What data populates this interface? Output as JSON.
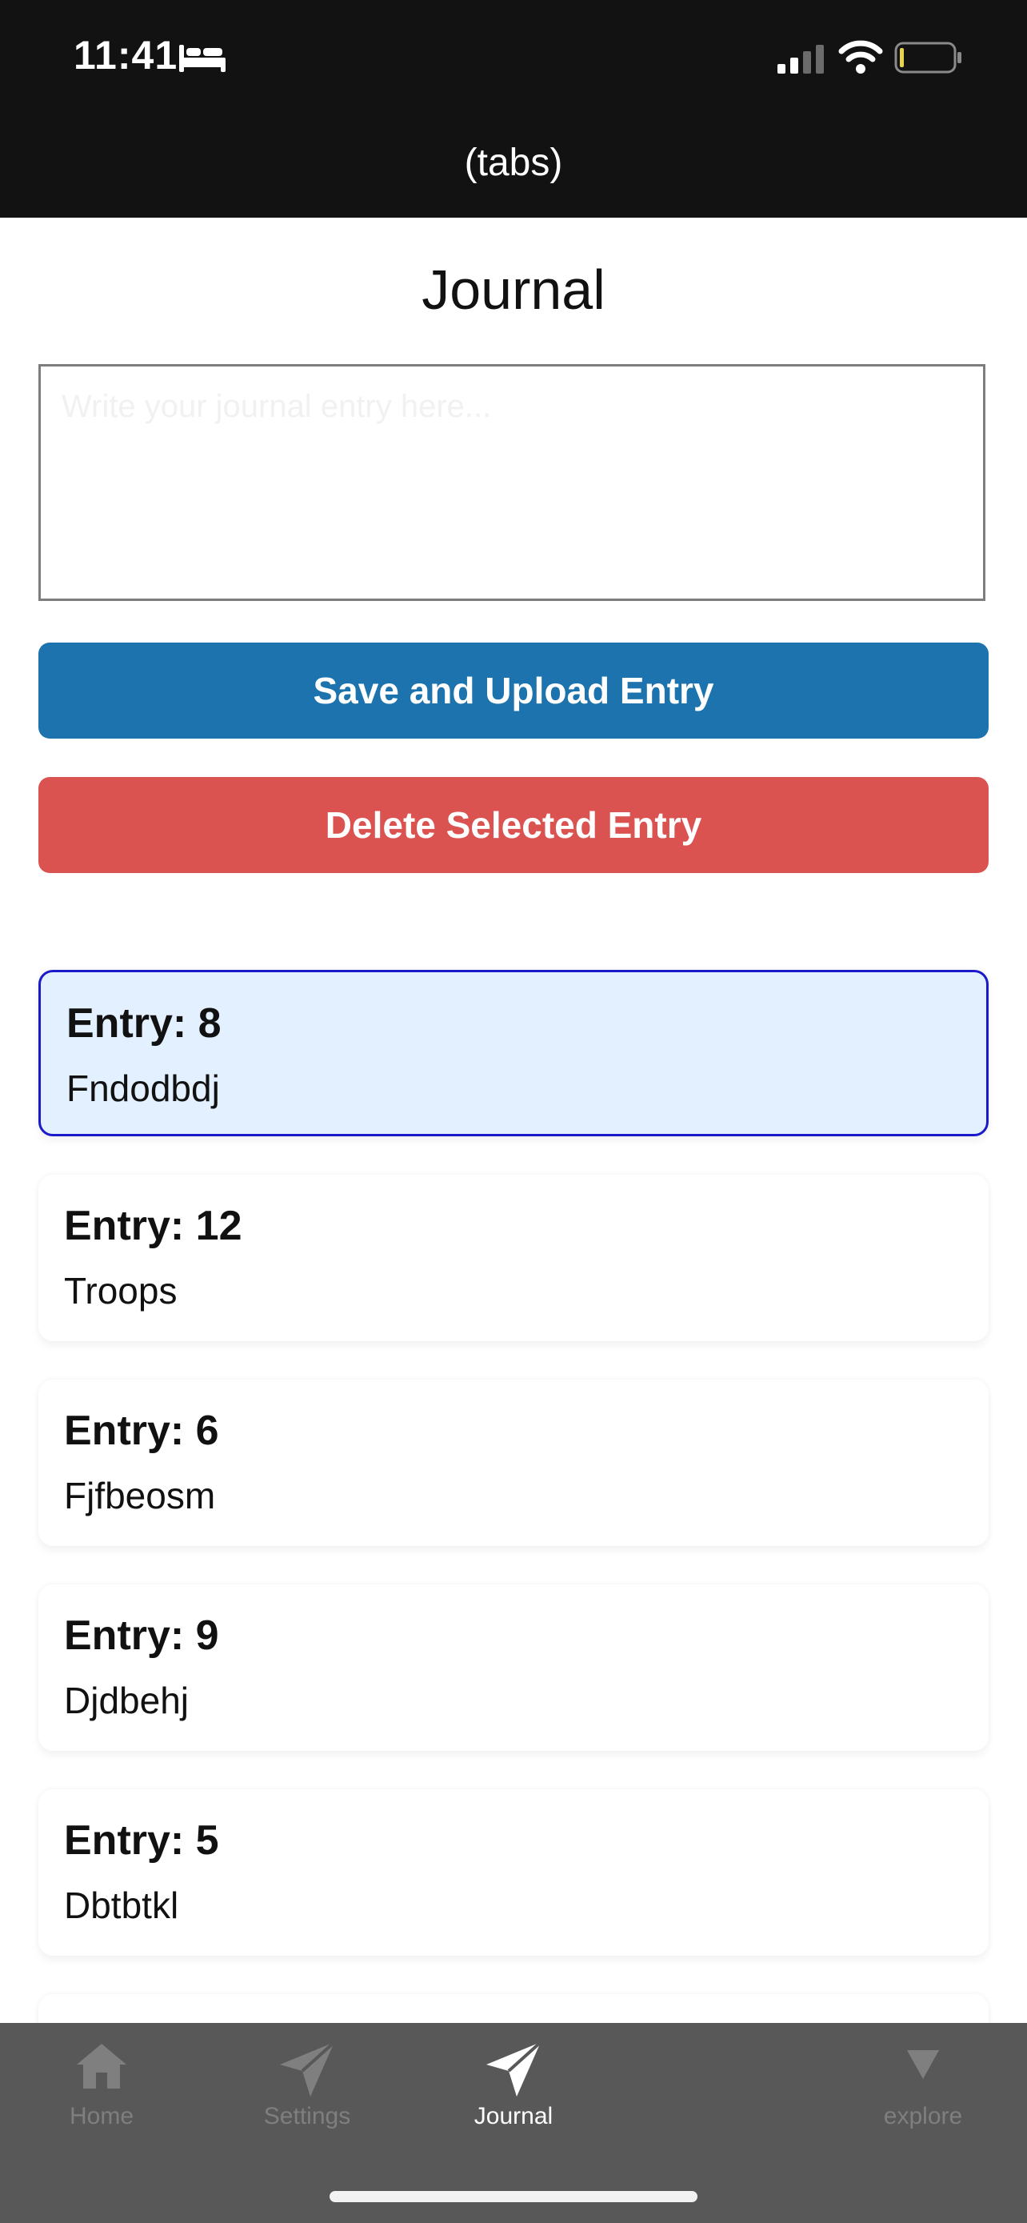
{
  "status_bar": {
    "time": "11:41",
    "icons": [
      "bed-icon",
      "signal-icon",
      "wifi-icon",
      "battery-icon"
    ]
  },
  "header": {
    "title": "(tabs)"
  },
  "page": {
    "title": "Journal"
  },
  "editor": {
    "placeholder": "Write your journal entry here...",
    "value": ""
  },
  "actions": {
    "save_label": "Save and Upload Entry",
    "delete_label": "Delete Selected Entry"
  },
  "entries": [
    {
      "title": "Entry: 8",
      "text": "Fndodbdj",
      "selected": true
    },
    {
      "title": "Entry: 12",
      "text": "Troops",
      "selected": false
    },
    {
      "title": "Entry: 6",
      "text": "Fjfbeosm",
      "selected": false
    },
    {
      "title": "Entry: 9",
      "text": "Djdbehj",
      "selected": false
    },
    {
      "title": "Entry: 5",
      "text": "Dbtbtkl",
      "selected": false
    }
  ],
  "tabs": [
    {
      "label": "Home",
      "icon": "home-icon",
      "active": false
    },
    {
      "label": "Settings",
      "icon": "send-icon",
      "active": false
    },
    {
      "label": "Journal",
      "icon": "send-icon",
      "active": true
    },
    {
      "label": "explore",
      "icon": "triangle-down-icon",
      "active": false
    }
  ],
  "colors": {
    "save": "#1d73ad",
    "delete": "#db5350",
    "selected_bg": "#e3f0ff",
    "selected_border": "#1a1ac8",
    "tabbar": "#585858"
  }
}
